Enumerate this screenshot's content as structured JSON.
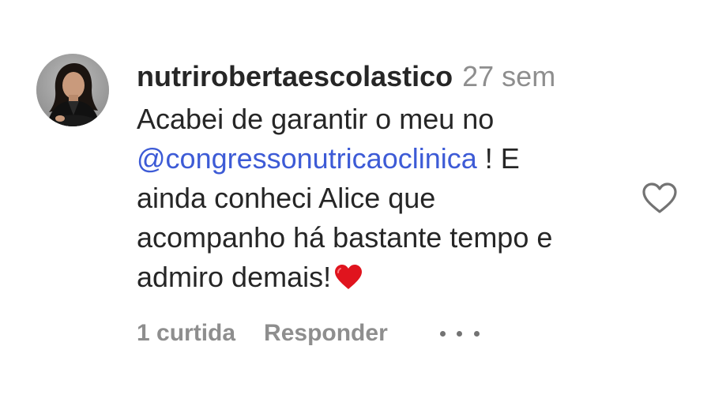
{
  "comment": {
    "username": "nutrirobertaescolastico",
    "timestamp": "27 sem",
    "text_lines": {
      "line1": "Acabei de garantir o meu no",
      "mention": "@congressonutricaoclinica",
      "line2_suffix": " ! E",
      "line3": "ainda conheci Alice que",
      "line4": "acompanho há bastante tempo e",
      "line5": "admiro demais!"
    },
    "emoji": "heart-emoji",
    "likes_label": "1 curtida",
    "reply_label": "Responder",
    "liked": false
  },
  "icons": {
    "like": "heart-outline-icon",
    "more": "more-options-icon",
    "avatar": "profile-photo"
  },
  "colors": {
    "text": "#262626",
    "secondary_text": "#8e8e8e",
    "mention": "#3d5bd6",
    "heart_emoji": "#e0141e",
    "like_outline": "#737373"
  }
}
